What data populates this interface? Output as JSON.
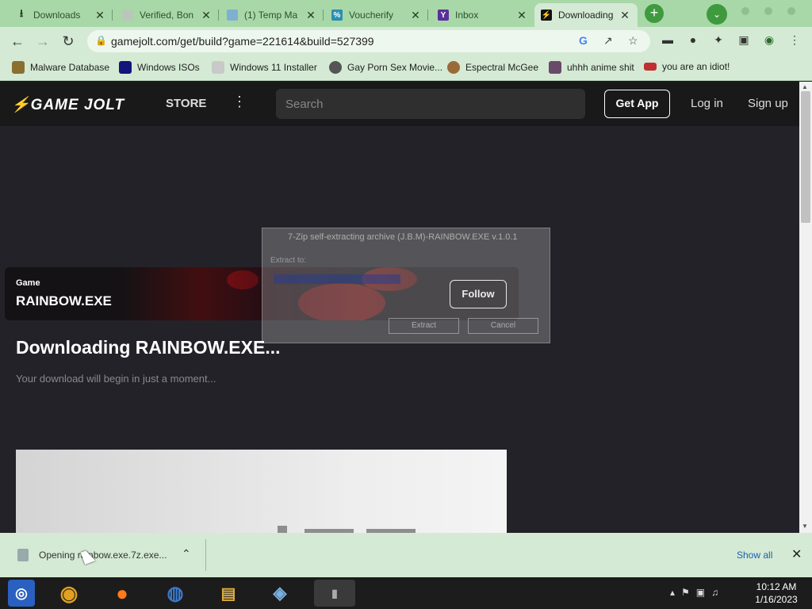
{
  "browser": {
    "tabs": [
      {
        "title": "Downloads",
        "favicon": "download-icon"
      },
      {
        "title": "Verified, Bon",
        "favicon": "page-icon"
      },
      {
        "title": "(1) Temp Ma",
        "favicon": "mail-icon"
      },
      {
        "title": "Voucherify",
        "favicon": "percent-icon"
      },
      {
        "title": "Inbox",
        "favicon": "yahoo-icon"
      },
      {
        "title": "Downloading",
        "favicon": "gamejolt-icon"
      }
    ],
    "url": "gamejolt.com/get/build?game=221614&build=527399",
    "bookmarks": [
      {
        "label": "Malware Database"
      },
      {
        "label": "Windows ISOs"
      },
      {
        "label": "Windows 11 Installer"
      },
      {
        "label": "Gay Porn Sex Movie..."
      },
      {
        "label": "Espectral McGee"
      },
      {
        "label": "uhhh anime shit"
      },
      {
        "label": "you are an idiot!"
      }
    ],
    "accent_color": "#a8d8a8"
  },
  "gamejolt": {
    "logo": "GAME JOLT",
    "store_label": "STORE",
    "search_placeholder": "Search",
    "get_app_label": "Get App",
    "login_label": "Log in",
    "signup_label": "Sign up",
    "game_label": "Game",
    "game_title": "RAINBOW.EXE",
    "follow_label": "Follow",
    "download_title": "Downloading RAINBOW.EXE...",
    "download_subtitle": "Your download will begin in just a moment..."
  },
  "ghost_dialog": {
    "title": "7-Zip self-extracting archive (J.B.M)-RAINBOW.EXE v.1.0.1",
    "extract_to_label": "Extract to:",
    "extract_label": "Extract",
    "cancel_label": "Cancel"
  },
  "download_bar": {
    "item_text": "Opening rainbow.exe.7z.exe...",
    "show_all_label": "Show all"
  },
  "taskbar": {
    "time": "10:12 AM",
    "date": "1/16/2023"
  }
}
